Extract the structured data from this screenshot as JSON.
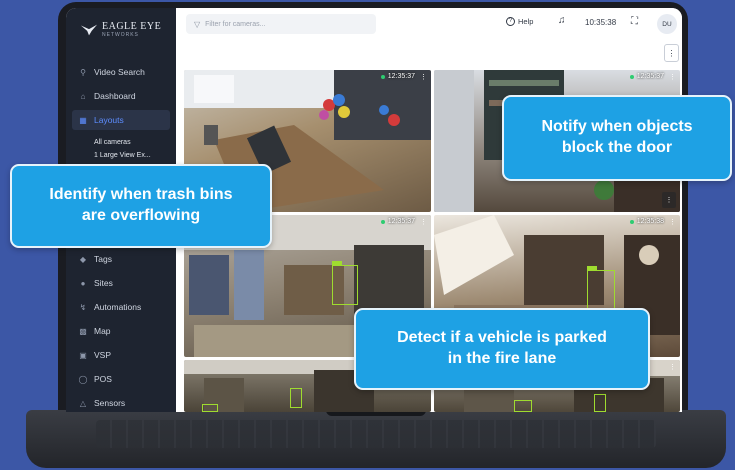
{
  "brand": {
    "name": "EAGLE EYE",
    "sub": "NETWORKS"
  },
  "sidebar": {
    "items": [
      {
        "label": "Video Search",
        "icon": "search-icon"
      },
      {
        "label": "Dashboard",
        "icon": "dashboard-icon"
      },
      {
        "label": "Layouts",
        "icon": "layouts-icon",
        "active": true
      },
      {
        "label": "Tags",
        "icon": "tag-icon"
      },
      {
        "label": "Sites",
        "icon": "location-pin-icon"
      },
      {
        "label": "Automations",
        "icon": "automation-icon"
      },
      {
        "label": "Map",
        "icon": "map-icon"
      },
      {
        "label": "VSP",
        "icon": "vehicle-icon"
      },
      {
        "label": "POS",
        "icon": "pos-icon"
      },
      {
        "label": "Sensors",
        "icon": "sensor-icon"
      }
    ],
    "layout_subitems": [
      "All cameras",
      "1 Large View Ex..."
    ]
  },
  "header": {
    "filter_placeholder": "Filter for cameras...",
    "help_label": "Help",
    "time": "10:35:38",
    "user_initials": "DU"
  },
  "cameras": [
    {
      "timestamp": "12:35:37"
    },
    {
      "timestamp": "12:35:37"
    },
    {
      "timestamp": "12:35:37"
    },
    {
      "timestamp": "12:35:38"
    },
    {
      "timestamp": ""
    },
    {
      "timestamp": ""
    }
  ],
  "callouts": {
    "trash": "Identify when trash bins\nare overflowing",
    "door": "Notify when objects\nblock the door",
    "vehicle": "Detect if a vehicle is parked\nin the fire lane"
  },
  "colors": {
    "background": "#3c57a6",
    "sidebar": "#1e2430",
    "accent": "#5d8dff",
    "callout": "#1ea1e4",
    "detection_box": "#9fdc2f"
  }
}
